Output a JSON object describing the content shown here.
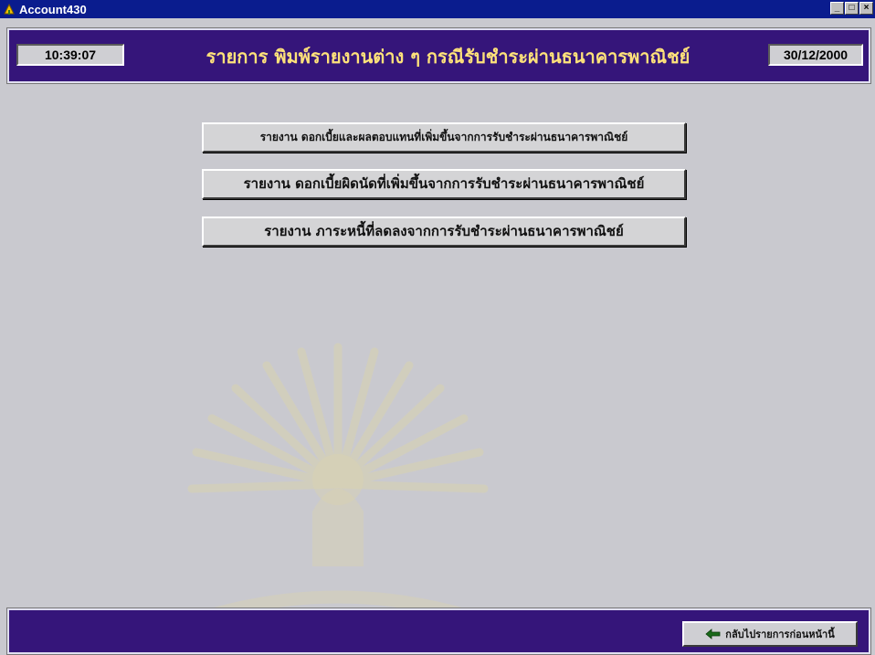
{
  "window": {
    "title": "Account430",
    "controls": [
      "minimize-icon",
      "maximize-icon",
      "close-icon"
    ]
  },
  "header": {
    "time": "10:39:07",
    "title": "รายการ พิมพ์รายงานต่าง ๆ กรณีรับชำระผ่านธนาคารพาณิชย์",
    "date": "30/12/2000"
  },
  "menu": {
    "report1": "รายงาน ดอกเบี้ยและผลตอบแทนที่เพิ่มขึ้นจากการรับชำระผ่านธนาคารพาณิชย์",
    "report2": "รายงาน ดอกเบี้ยผิดนัดที่เพิ่มขึ้นจากการรับชำระผ่านธนาคารพาณิชย์",
    "report3": "รายงาน ภาระหนี้ที่ลดลงจากการรับชำระผ่านธนาคารพาณิชย์"
  },
  "footer": {
    "back_label": "กลับไปรายการก่อนหน้านี้",
    "back_icon": "back-arrow-icon"
  },
  "colors": {
    "titlebar": "#0a1c8e",
    "panel": "#35157a",
    "heading_text": "#ffe27a",
    "background": "#c9c9cf"
  }
}
